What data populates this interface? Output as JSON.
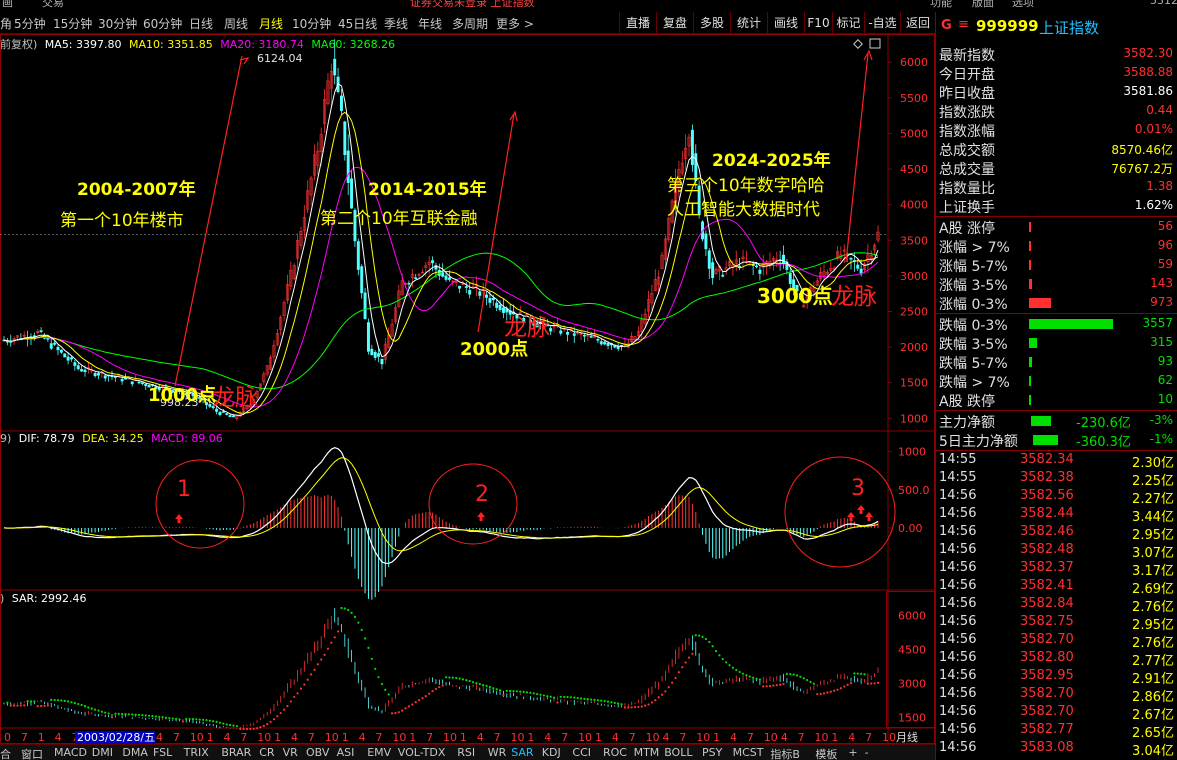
{
  "topstrip": {
    "left1": "画",
    "left2": "交易",
    "center": "证券交易未登录  上证指数",
    "r1": "功能",
    "r2": "版面",
    "r3": "选项",
    "r4": "5312"
  },
  "toolbar": {
    "left": [
      "角",
      "5分钟",
      "15分钟",
      "30分钟",
      "60分钟",
      "日线",
      "周线",
      "月线",
      "10分钟",
      "45日线",
      "季线",
      "年线",
      "多周期",
      "更多 >"
    ],
    "active_index": 7,
    "right": [
      "直播",
      "复盘",
      "多股",
      "统计",
      "画线",
      "F10",
      "标记",
      "-自选",
      "返回"
    ]
  },
  "main_legend": {
    "prefix": "前复权)",
    "ma5": "MA5: 3397.80",
    "ma10": "MA10: 3351.85",
    "ma20": "MA20: 3180.74",
    "ma60": "MA60: 3268.26"
  },
  "macd_legend": {
    "prefix": "9)",
    "dif": "DIF: 78.79",
    "dea": "DEA: 34.25",
    "macd": "MACD: 89.06"
  },
  "sar_legend": {
    "prefix": ")",
    "sar": "SAR: 2992.46"
  },
  "price_axis": [
    "6000",
    "5500",
    "5000",
    "4500",
    "4000",
    "3500",
    "3000",
    "2500",
    "2000",
    "1500",
    "1000"
  ],
  "macd_axis": [
    "1000",
    "500.0",
    "0.00"
  ],
  "sar_axis": [
    "6000",
    "4500",
    "3000",
    "1500"
  ],
  "annotations": {
    "high": "6124.04",
    "low": "998.23",
    "t1a": "2004-2007年",
    "t1b": "第一个10年楼市",
    "t2a": "2014-2015年",
    "t2b": "第二个10年互联金融",
    "t3a": "2024-2025年",
    "t3b": "第三个10年数字哈哈",
    "t3c": "人工智能大数据时代",
    "p1000": "1000点",
    "p2000": "2000点",
    "p3000": "3000点",
    "dragon": "龙脉",
    "n1": "1",
    "n2": "2",
    "n3": "3"
  },
  "x_axis": {
    "labels": [
      "0",
      "7",
      "1",
      "4",
      "7",
      "10",
      "1",
      "4",
      "7",
      "4",
      "7",
      "10",
      "1",
      "4",
      "7",
      "10",
      "1",
      "4",
      "7",
      "10",
      "1",
      "4",
      "7",
      "10",
      "1",
      "7",
      "10",
      "1",
      "4",
      "7",
      "10",
      "1",
      "4",
      "7",
      "10",
      "1",
      "4",
      "7",
      "10",
      "4",
      "7",
      "10",
      "1",
      "4",
      "7",
      "10",
      "4",
      "7",
      "10",
      "1",
      "4",
      "7",
      "10"
    ],
    "highlight": "2003/02/28/五",
    "period": "月线"
  },
  "bottom_tabs": {
    "items": [
      "合",
      "窗口",
      "MACD",
      "DMI",
      "DMA",
      "FSL",
      "TRIX",
      "BRAR",
      "CR",
      "VR",
      "OBV",
      "ASI",
      "EMV",
      "VOL-TDX",
      "RSI",
      "WR",
      "SAR",
      "KDJ",
      "CCI",
      "ROC",
      "MTM",
      "BOLL",
      "PSY",
      "MCST",
      "指标B",
      "模板",
      "+",
      "-"
    ],
    "active": "SAR"
  },
  "side": {
    "g": "G",
    "menu": "≡",
    "code": "999999",
    "name": "上证指数",
    "quote": [
      {
        "label": "最新指数",
        "value": "3582.30",
        "cls": "red"
      },
      {
        "label": "今日开盘",
        "value": "3588.88",
        "cls": "red"
      },
      {
        "label": "昨日收盘",
        "value": "3581.86",
        "cls": "white"
      },
      {
        "label": "指数涨跌",
        "value": "0.44",
        "cls": "red"
      },
      {
        "label": "指数涨幅",
        "value": "0.01%",
        "cls": "red"
      },
      {
        "label": "总成交额",
        "value": "8570.46亿",
        "cls": "yellow"
      },
      {
        "label": "总成交量",
        "value": "76767.2万",
        "cls": "yellow"
      },
      {
        "label": "指数量比",
        "value": "1.38",
        "cls": "red"
      },
      {
        "label": "上证换手",
        "value": "1.62%",
        "cls": "white"
      }
    ],
    "up": [
      {
        "label": "A股 涨停",
        "value": "56",
        "frac": 0.0
      },
      {
        "label": "涨幅 > 7%",
        "value": "96",
        "frac": 0.03
      },
      {
        "label": "涨幅 5-7%",
        "value": "59",
        "frac": 0.02
      },
      {
        "label": "涨幅 3-5%",
        "value": "143",
        "frac": 0.04
      },
      {
        "label": "涨幅 0-3%",
        "value": "973",
        "frac": 0.27
      }
    ],
    "down": [
      {
        "label": "跌幅 0-3%",
        "value": "3557",
        "frac": 1.0
      },
      {
        "label": "跌幅 3-5%",
        "value": "315",
        "frac": 0.09
      },
      {
        "label": "跌幅 5-7%",
        "value": "93",
        "frac": 0.03
      },
      {
        "label": "跌幅 > 7%",
        "value": "62",
        "frac": 0.02
      },
      {
        "label": "A股 跌停",
        "value": "10",
        "frac": 0.0
      }
    ],
    "flow": [
      {
        "label": "主力净额",
        "value": "-230.6亿",
        "pct": "-3%"
      },
      {
        "label": "5日主力净额",
        "value": "-360.3亿",
        "pct": "-1%"
      }
    ],
    "ticks": [
      {
        "t": "14:55",
        "p": "3582.34",
        "v": "2.30亿"
      },
      {
        "t": "14:55",
        "p": "3582.38",
        "v": "2.25亿"
      },
      {
        "t": "14:56",
        "p": "3582.56",
        "v": "2.27亿"
      },
      {
        "t": "14:56",
        "p": "3582.44",
        "v": "3.44亿"
      },
      {
        "t": "14:56",
        "p": "3582.46",
        "v": "2.95亿"
      },
      {
        "t": "14:56",
        "p": "3582.48",
        "v": "3.07亿"
      },
      {
        "t": "14:56",
        "p": "3582.37",
        "v": "3.17亿"
      },
      {
        "t": "14:56",
        "p": "3582.41",
        "v": "2.69亿"
      },
      {
        "t": "14:56",
        "p": "3582.84",
        "v": "2.76亿"
      },
      {
        "t": "14:56",
        "p": "3582.75",
        "v": "2.95亿"
      },
      {
        "t": "14:56",
        "p": "3582.70",
        "v": "2.76亿"
      },
      {
        "t": "14:56",
        "p": "3582.80",
        "v": "2.77亿"
      },
      {
        "t": "14:56",
        "p": "3582.95",
        "v": "2.91亿"
      },
      {
        "t": "14:56",
        "p": "3582.70",
        "v": "2.86亿"
      },
      {
        "t": "14:56",
        "p": "3582.70",
        "v": "2.67亿"
      },
      {
        "t": "14:56",
        "p": "3582.77",
        "v": "2.65亿"
      },
      {
        "t": "14:56",
        "p": "3583.08",
        "v": "3.04亿"
      }
    ]
  },
  "colors": {
    "up": "#ff3333",
    "down": "#54ffff",
    "ma5": "#ffffff",
    "ma10": "#ffff00",
    "ma20": "#ff00ff",
    "ma60": "#00ff00",
    "frame": "#8b0000",
    "annot_yellow": "#ffff00",
    "annot_red": "#ff2020"
  }
}
